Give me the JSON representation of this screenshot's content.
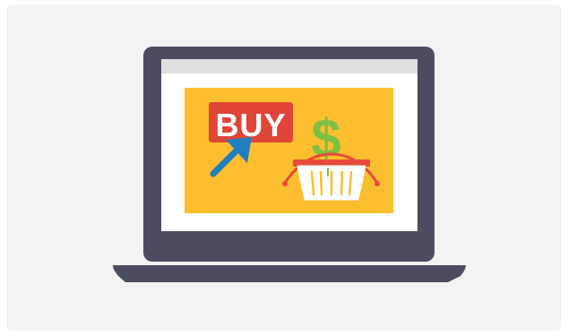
{
  "illustration": {
    "buy_text": "BUY",
    "dollar_text": "$",
    "icons": [
      "laptop-icon",
      "buy-sign-icon",
      "cursor-arrow-icon",
      "dollar-sign-icon",
      "shopping-basket-icon"
    ]
  },
  "colors": {
    "card_background": "#f3f3f3",
    "laptop_body": "#4a4d60",
    "screen_bezel_top": "#dfe1e1",
    "screen_panel": "#ffffff",
    "banner_yellow": "#fbbe2e",
    "buy_red": "#df4637",
    "arrow_blue": "#1f7fc0",
    "dollar_green": "#7fbf44",
    "basket_red": "#e84a3a"
  }
}
